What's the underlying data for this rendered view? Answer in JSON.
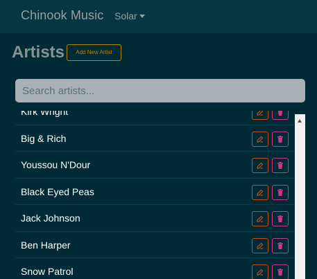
{
  "navbar": {
    "brand": "Chinook Music",
    "theme_dropdown": "Solar"
  },
  "page": {
    "title": "Artists",
    "add_button": "Add New Artist"
  },
  "search": {
    "placeholder": "Search artists...",
    "value": ""
  },
  "artists": [
    "Kirk Wright",
    "Big & Rich",
    "Youssou N'Dour",
    "Black Eyed Peas",
    "Jack Johnson",
    "Ben Harper",
    "Snow Patrol"
  ],
  "icons": {
    "edit": "edit-icon",
    "delete": "trash-icon"
  },
  "colors": {
    "background": "#002b36",
    "navbar": "#073642",
    "accent_warning": "#b58900",
    "edit": "#cb4b16",
    "delete": "#d33682"
  }
}
